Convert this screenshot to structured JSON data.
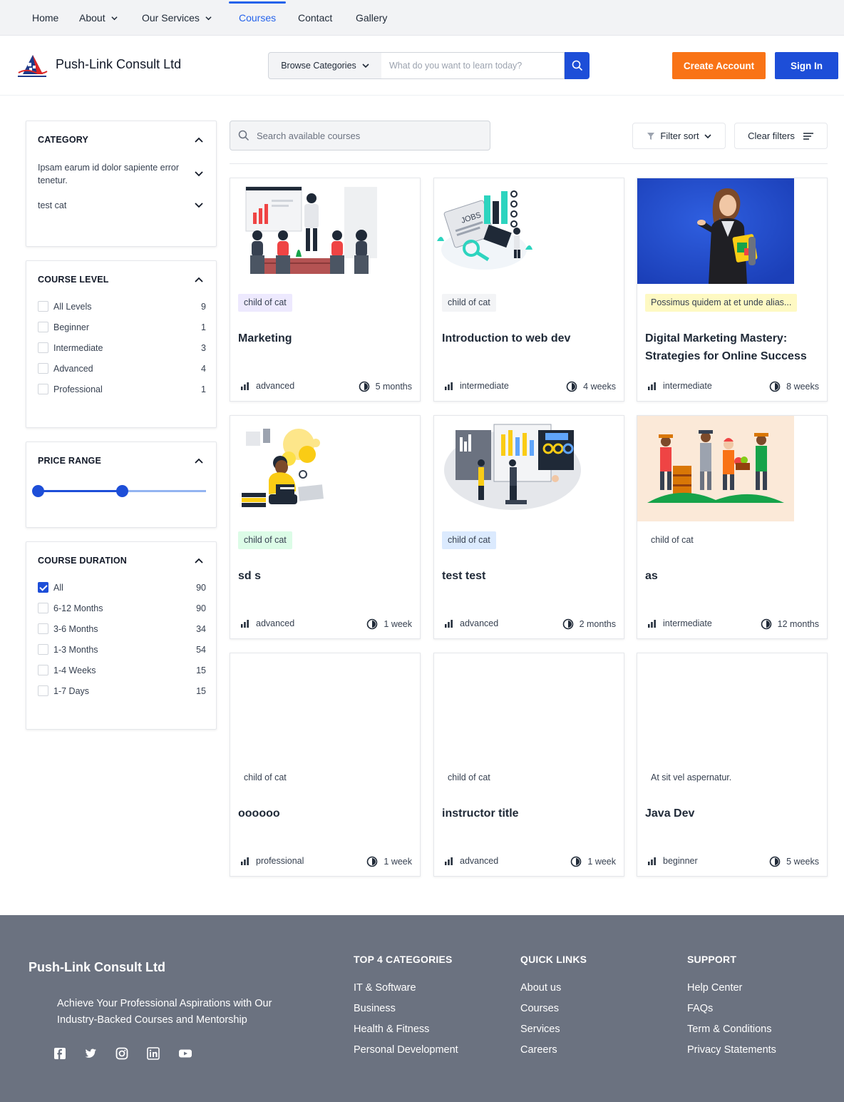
{
  "nav": {
    "home": "Home",
    "about": "About",
    "services": "Our Services",
    "courses": "Courses",
    "contact": "Contact",
    "gallery": "Gallery"
  },
  "header": {
    "brand": "Push-Link Consult Ltd",
    "browse_label": "Browse Categories",
    "search_placeholder": "What do you want to learn today?",
    "create_account": "Create Account",
    "sign_in": "Sign In"
  },
  "sidebar": {
    "category": {
      "title": "CATEGORY",
      "items": [
        "Ipsam earum id dolor sapiente error tenetur.",
        "test cat"
      ]
    },
    "level": {
      "title": "COURSE LEVEL",
      "items": [
        {
          "label": "All Levels",
          "count": "9"
        },
        {
          "label": "Beginner",
          "count": "1"
        },
        {
          "label": "Intermediate",
          "count": "3"
        },
        {
          "label": "Advanced",
          "count": "4"
        },
        {
          "label": "Professional",
          "count": "1"
        }
      ]
    },
    "price": {
      "title": "PRICE RANGE",
      "range_start": 0,
      "range_end": 0.5
    },
    "duration": {
      "title": "COURSE DURATION",
      "items": [
        {
          "label": "All",
          "count": "90",
          "checked": true
        },
        {
          "label": "6-12 Months",
          "count": "90",
          "checked": false
        },
        {
          "label": "3-6 Months",
          "count": "34",
          "checked": false
        },
        {
          "label": "1-3 Months",
          "count": "54",
          "checked": false
        },
        {
          "label": "1-4 Weeks",
          "count": "15",
          "checked": false
        },
        {
          "label": "1-7 Days",
          "count": "15",
          "checked": false
        }
      ]
    }
  },
  "main": {
    "search_placeholder": "Search available courses",
    "filter_sort": "Filter sort",
    "clear_filters": "Clear filters",
    "courses": [
      {
        "tag": "child of cat",
        "tag_color": "#ede9fe",
        "title": "Marketing",
        "level": "advanced",
        "duration": "5 months",
        "image": "presentation-illustration"
      },
      {
        "tag": "child of cat",
        "tag_color": "#f3f4f6",
        "title": "Introduction to web dev",
        "level": "intermediate",
        "duration": "4 weeks",
        "image": "jobs-illustration"
      },
      {
        "tag": "Possimus quidem at et unde alias...",
        "tag_color": "#fef9c3",
        "title": "Digital Marketing Mastery: Strategies for Online Success",
        "level": "intermediate",
        "duration": "8 weeks",
        "image": "student-photo"
      },
      {
        "tag": "child of cat",
        "tag_color": "#dcfce7",
        "title": "sd s",
        "level": "advanced",
        "duration": "1 week",
        "image": "reading-illustration"
      },
      {
        "tag": "child of cat",
        "tag_color": "#dbeafe",
        "title": "test test",
        "level": "advanced",
        "duration": "2 months",
        "image": "dashboard-illustration"
      },
      {
        "tag": "child of cat",
        "tag_color": "#ffffff",
        "title": "as",
        "level": "intermediate",
        "duration": "12 months",
        "image": "farmers-illustration"
      },
      {
        "tag": "child of cat",
        "tag_color": "#ffffff",
        "title": "oooooo",
        "level": "professional",
        "duration": "1 week",
        "image": ""
      },
      {
        "tag": "child of cat",
        "tag_color": "#ffffff",
        "title": "instructor title",
        "level": "advanced",
        "duration": "1 week",
        "image": ""
      },
      {
        "tag": "At sit vel aspernatur.",
        "tag_color": "#ffffff",
        "title": "Java Dev",
        "level": "beginner",
        "duration": "5 weeks",
        "image": ""
      }
    ]
  },
  "footer": {
    "brand": "Push-Link Consult Ltd",
    "tagline": "Achieve Your Professional Aspirations with Our Industry-Backed Courses and Mentorship",
    "social": [
      "facebook-icon",
      "twitter-icon",
      "instagram-icon",
      "linkedin-icon",
      "youtube-icon"
    ],
    "top_categories": {
      "title": "TOP 4 CATEGORIES",
      "links": [
        "IT & Software",
        "Business",
        "Health & Fitness",
        "Personal Development"
      ]
    },
    "quick_links": {
      "title": "QUICK LINKS",
      "links": [
        "About us",
        "Courses",
        "Services",
        "Careers"
      ]
    },
    "support": {
      "title": "SUPPORT",
      "links": [
        "Help Center",
        "FAQs",
        "Term & Conditions",
        "Privacy Statements"
      ]
    }
  },
  "colors": {
    "primary": "#1d4ed8",
    "accent": "#f97316",
    "footer_bg": "#6b7280"
  }
}
